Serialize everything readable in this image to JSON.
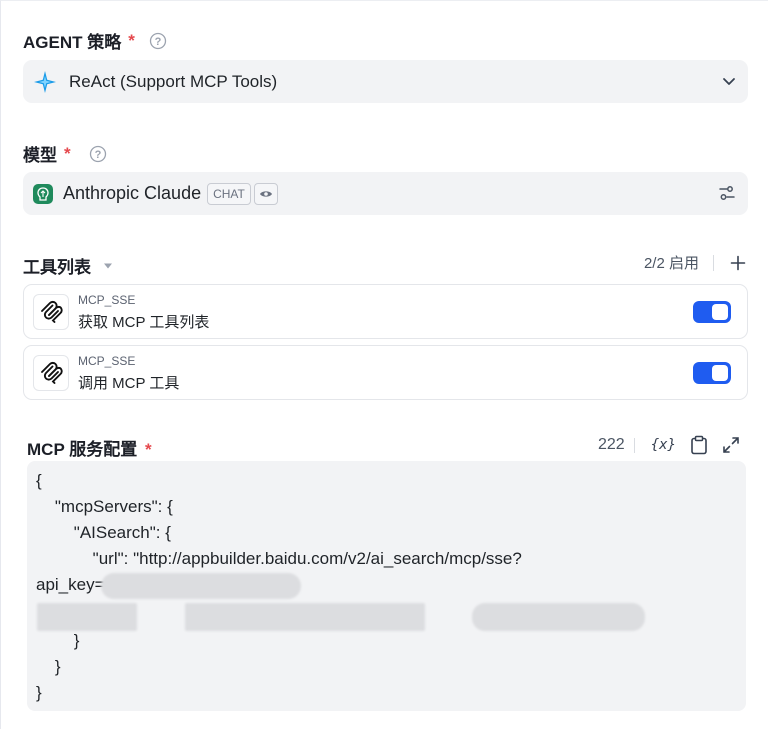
{
  "agent_strategy": {
    "label": "AGENT 策略",
    "required_mark": "*",
    "selected": "ReAct (Support MCP Tools)"
  },
  "model": {
    "label": "模型",
    "required_mark": "*",
    "name": "Anthropic Claude",
    "tag": "CHAT"
  },
  "tools": {
    "label": "工具列表",
    "enabled_status": "2/2 启用",
    "add_label": "+",
    "items": [
      {
        "provider": "MCP_SSE",
        "name": "获取 MCP 工具列表",
        "enabled": true
      },
      {
        "provider": "MCP_SSE",
        "name": "调用 MCP 工具",
        "enabled": true
      }
    ]
  },
  "mcp_config": {
    "label": "MCP 服务配置",
    "required_mark": "*",
    "char_count": "222",
    "variable_icon_label": "{x}",
    "code_lines": [
      "{",
      "    \"mcpServers\": {",
      "        \"AISearch\": {",
      "            \"url\": \"http://appbuilder.baidu.com/v2/ai_search/mcp/sse?",
      "api_key=",
      "",
      "        }",
      "    }",
      "}"
    ]
  },
  "colors": {
    "accent": "#1f5cf0",
    "required": "#e5484d",
    "field_bg": "#f2f3f5"
  }
}
